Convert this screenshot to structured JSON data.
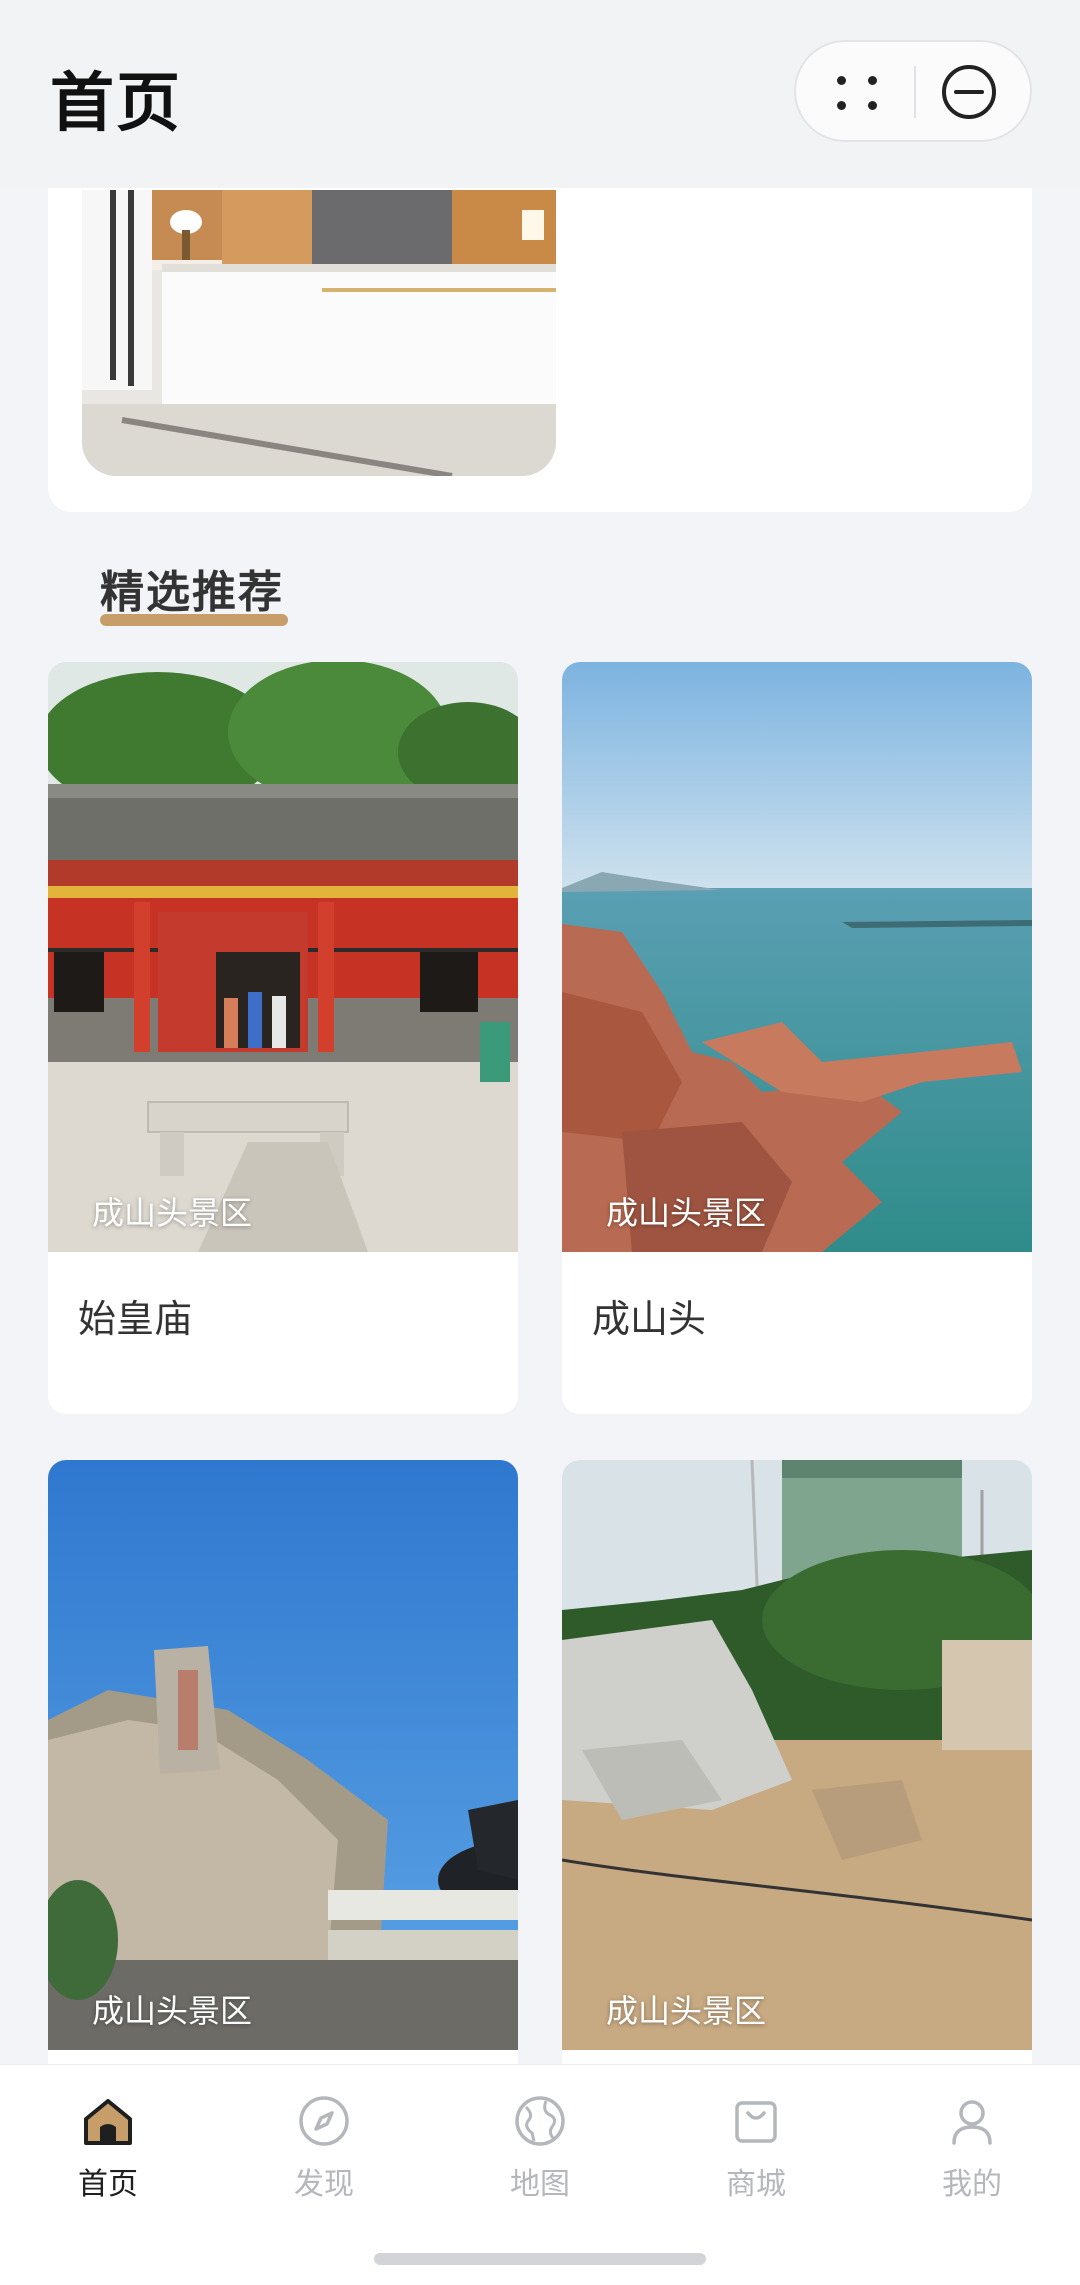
{
  "header": {
    "title": "首页"
  },
  "section": {
    "title": "精选推荐"
  },
  "cards": [
    {
      "area": "成山头景区",
      "name": "始皇庙"
    },
    {
      "area": "成山头景区",
      "name": "成山头"
    },
    {
      "area": "成山头景区",
      "name": ""
    },
    {
      "area": "成山头景区",
      "name": ""
    }
  ],
  "tabs": [
    {
      "label": "首页",
      "icon": "home-icon",
      "active": true
    },
    {
      "label": "发现",
      "icon": "compass-icon",
      "active": false
    },
    {
      "label": "地图",
      "icon": "globe-icon",
      "active": false
    },
    {
      "label": "商城",
      "icon": "shopping-bag-icon",
      "active": false
    },
    {
      "label": "我的",
      "icon": "user-icon",
      "active": false
    }
  ],
  "colors": {
    "accent": "#c79e6a",
    "background": "#f2f4f7",
    "tab_inactive": "#b4b7bc",
    "tab_active": "#1f1f1f"
  }
}
